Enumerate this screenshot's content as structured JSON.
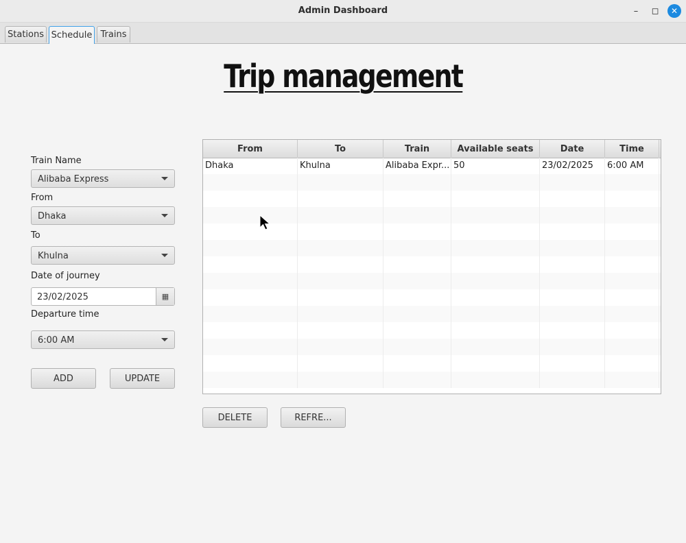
{
  "window": {
    "title": "Admin Dashboard"
  },
  "tabs": [
    {
      "label": "Stations"
    },
    {
      "label": "Schedule"
    },
    {
      "label": "Trains"
    }
  ],
  "page_title": "Trip management",
  "form": {
    "train_name_label": "Train Name",
    "train_name_value": "Alibaba Express",
    "from_label": "From",
    "from_value": "Dhaka",
    "to_label": "To",
    "to_value": "Khulna",
    "date_label": "Date of journey",
    "date_value": "23/02/2025",
    "time_label": "Departure time",
    "time_value": "6:00 AM",
    "add_label": "ADD",
    "update_label": "UPDATE"
  },
  "table": {
    "columns": [
      "From",
      "To",
      "Train",
      "Available seats",
      "Date",
      "Time"
    ],
    "rows": [
      [
        "Dhaka",
        "Khulna",
        "Alibaba Expr...",
        "50",
        "23/02/2025",
        "6:00 AM"
      ]
    ]
  },
  "actions": {
    "delete_label": "DELETE",
    "refresh_label": "REFRE..."
  }
}
